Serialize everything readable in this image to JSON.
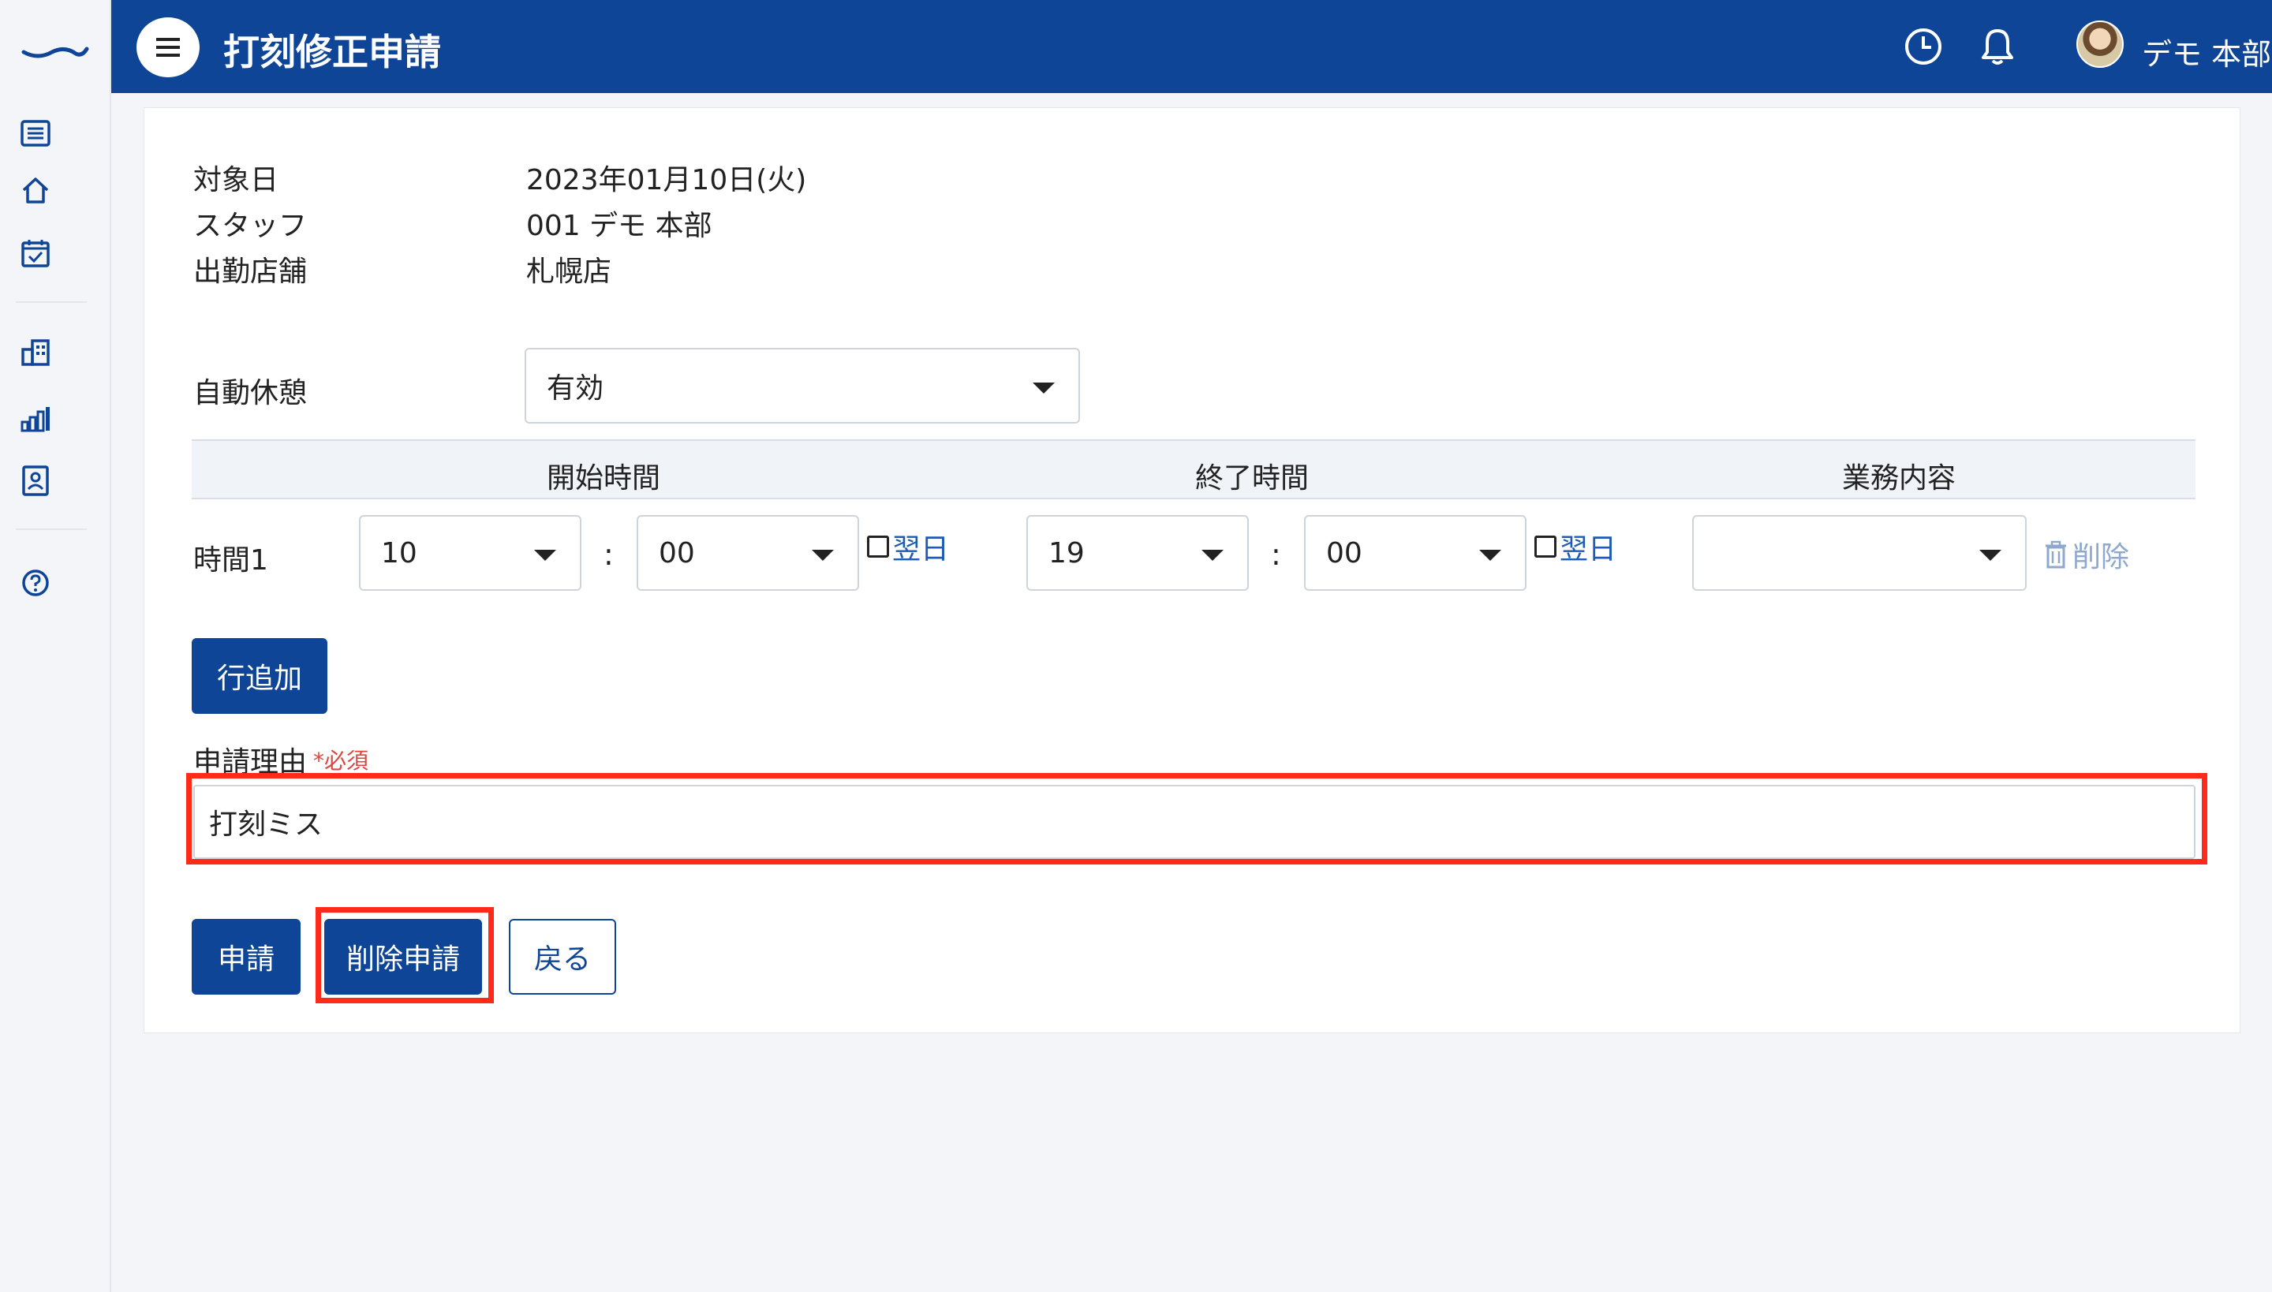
{
  "colors": {
    "primary": "#0f4597",
    "highlight": "#ff2a1a",
    "required": "#e0453d",
    "link": "#1f5bb3"
  },
  "sidebar": {
    "icons": [
      "logo-icon",
      "list-icon",
      "home-icon",
      "calendar-check-icon",
      "building-icon",
      "bar-chart-icon",
      "id-card-icon",
      "help-icon"
    ]
  },
  "header": {
    "title": "打刻修正申請",
    "user_name": "デモ 本部",
    "icons": [
      "menu-icon",
      "clock-icon",
      "bell-icon"
    ]
  },
  "info": {
    "target_date_label": "対象日",
    "target_date_value": "2023年01月10日(火)",
    "staff_label": "スタッフ",
    "staff_value": "001 デモ 本部",
    "store_label": "出勤店舗",
    "store_value": "札幌店"
  },
  "auto_break": {
    "label": "自動休憩",
    "value": "有効"
  },
  "table": {
    "headers": {
      "start": "開始時間",
      "end": "終了時間",
      "task": "業務内容"
    },
    "rows": [
      {
        "label": "時間1",
        "start_hour": "10",
        "start_minute": "00",
        "start_next_day": "翌日",
        "end_hour": "19",
        "end_minute": "00",
        "end_next_day": "翌日",
        "task": "",
        "delete_label": "削除"
      }
    ],
    "colon": ":"
  },
  "add_row_label": "行追加",
  "reason": {
    "label": "申請理由",
    "required": "*必須",
    "value": "打刻ミス"
  },
  "actions": {
    "apply": "申請",
    "delete_apply": "削除申請",
    "back": "戻る"
  }
}
